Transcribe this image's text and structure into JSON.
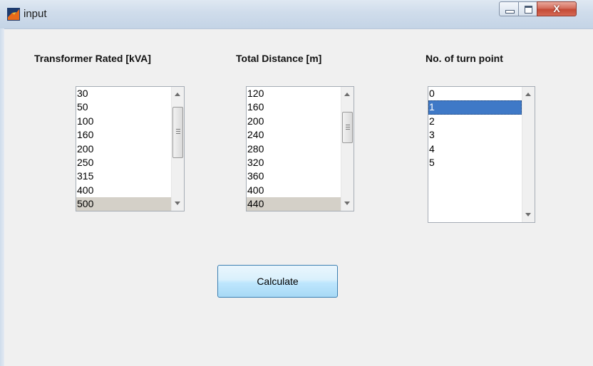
{
  "window": {
    "title": "input",
    "icon": "matlab-icon",
    "controls": {
      "minimize": "minimize-icon",
      "maximize": "maximize-icon",
      "close": "X"
    }
  },
  "transformer": {
    "label": "Transformer Rated [kVA]",
    "options": [
      "30",
      "50",
      "100",
      "160",
      "200",
      "250",
      "315",
      "400",
      "500"
    ],
    "selected": "500"
  },
  "distance": {
    "label": "Total Distance [m]",
    "options": [
      "120",
      "160",
      "200",
      "240",
      "280",
      "320",
      "360",
      "400",
      "440"
    ],
    "selected": "440"
  },
  "turns": {
    "label": "No. of turn point",
    "options": [
      "0",
      "1",
      "2",
      "3",
      "4",
      "5"
    ],
    "selected": "1"
  },
  "calculate_label": "Calculate",
  "colors": {
    "list_selection_gray": "#d4d0c8",
    "list_selection_blue": "#3f79c7",
    "close_button": "#c44a36",
    "button_blue": "#bee6fd"
  }
}
